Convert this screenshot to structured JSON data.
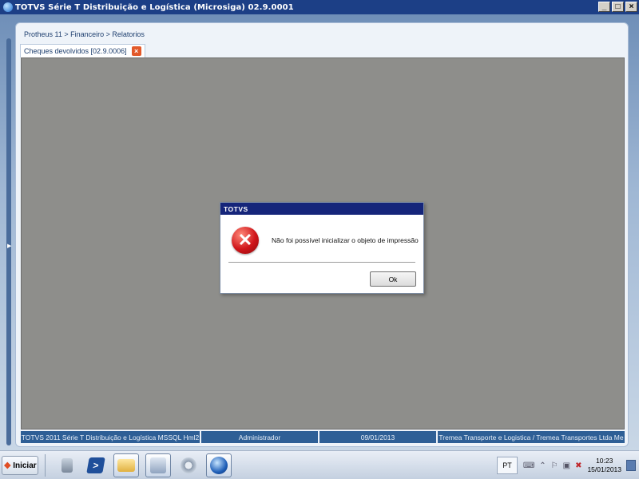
{
  "window": {
    "title": "TOTVS Série T Distribuição e Logística (Microsiga) 02.9.0001",
    "minimize": "_",
    "maximize": "□",
    "close": "×"
  },
  "breadcrumb": "Protheus 11 > Financeiro > Relatorios",
  "tab": {
    "label": "Cheques devolvidos [02.9.0006]",
    "close": "×"
  },
  "statusbar": [
    "TOTVS 2011 Série T Distribuição e Logística MSSQL Hml2",
    "Administrador",
    "09/01/2013",
    "Tremea Transporte e Logistica / Tremea Transportes Ltda Me"
  ],
  "dialog": {
    "title": "TOTVS",
    "icon": "error-icon",
    "message": "Não foi possível inicializar o objeto de impressão",
    "ok_label": "Ok"
  },
  "taskbar": {
    "start_label": "Iniciar",
    "apps": [
      "server-manager-icon",
      "powershell-icon",
      "explorer-icon",
      "tools-icon",
      "settings-icon",
      "totvs-app-icon"
    ],
    "language": "PT",
    "time": "10:23",
    "date": "15/01/2013"
  },
  "colors": {
    "titlebar": "#1c3f86",
    "dialog_title": "#15257a",
    "status_bg": "#2e5f96",
    "content_bg": "#8e8e8b",
    "error_red": "#d0151a"
  }
}
